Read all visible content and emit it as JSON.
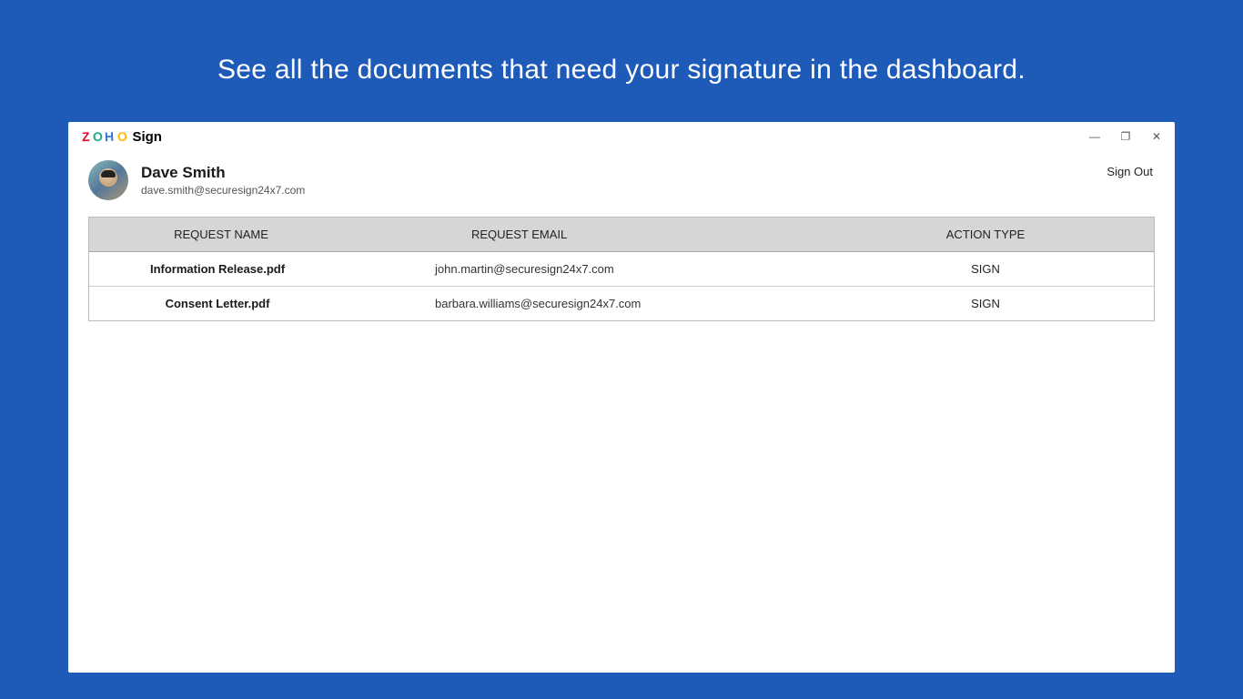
{
  "page": {
    "heading": "See all the documents that need your signature in the dashboard."
  },
  "app": {
    "logo_letters": [
      "Z",
      "O",
      "H",
      "O"
    ],
    "name": "Sign"
  },
  "window_controls": {
    "minimize": "—",
    "maximize": "❐",
    "close": "✕"
  },
  "user": {
    "name": "Dave Smith",
    "email": "dave.smith@securesign24x7.com"
  },
  "actions": {
    "signout": "Sign Out"
  },
  "table": {
    "headers": {
      "name": "REQUEST NAME",
      "email": "REQUEST EMAIL",
      "action": "ACTION TYPE"
    },
    "rows": [
      {
        "name": "Information Release.pdf",
        "email": "john.martin@securesign24x7.com",
        "action": "SIGN"
      },
      {
        "name": "Consent Letter.pdf",
        "email": "barbara.williams@securesign24x7.com",
        "action": "SIGN"
      }
    ]
  }
}
